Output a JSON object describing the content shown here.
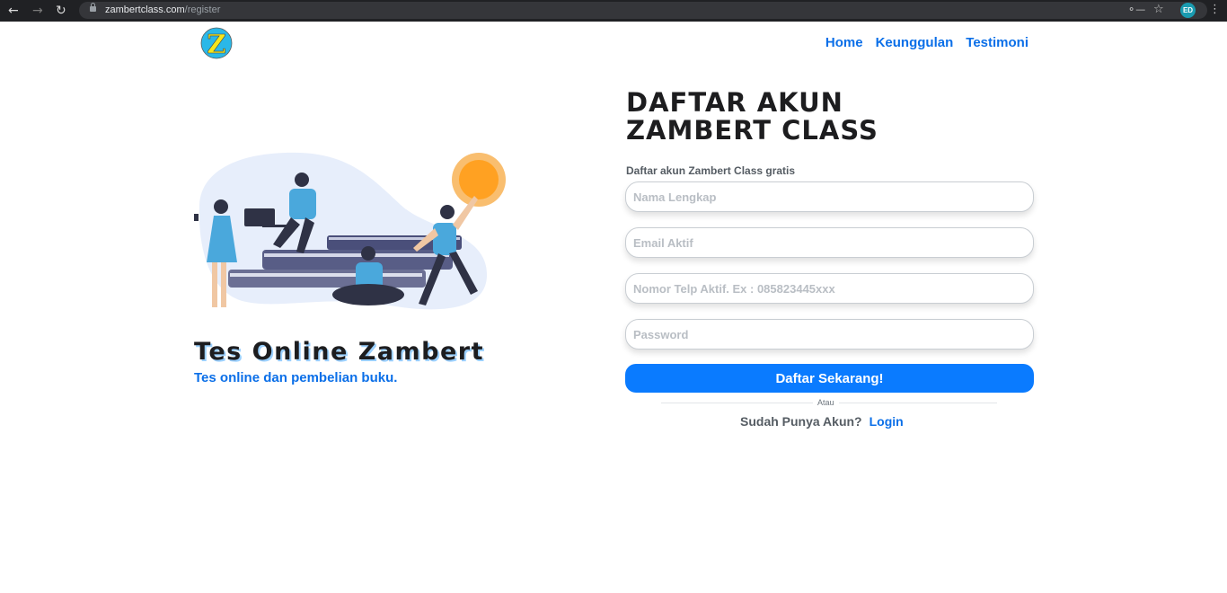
{
  "browser": {
    "url_host": "zambertclass.com",
    "url_path": "/register",
    "profile_initials": "ED"
  },
  "logo": {
    "letter": "Z"
  },
  "nav": {
    "items": [
      "Home",
      "Keunggulan",
      "Testimoni"
    ]
  },
  "hero": {
    "title": "Tes Online Zambert",
    "subtitle": "Tes online dan pembelian buku."
  },
  "form": {
    "title_line1": "DAFTAR AKUN",
    "title_line2": "ZAMBERT CLASS",
    "subtitle": "Daftar akun Zambert Class gratis",
    "fields": {
      "name": {
        "value": "",
        "placeholder": "Nama Lengkap"
      },
      "email": {
        "value": "",
        "placeholder": "Email Aktif"
      },
      "phone": {
        "value": "",
        "placeholder": "Nomor Telp Aktif. Ex : 085823445xxx"
      },
      "password": {
        "value": "",
        "placeholder": "Password"
      }
    },
    "submit_label": "Daftar Sekarang!",
    "divider_text": "Atau",
    "login_prompt": "Sudah Punya Akun?",
    "login_link": "Login"
  },
  "colors": {
    "brand_blue": "#0a7bff",
    "link_blue": "#0b6fe8",
    "logo_circle": "#2ab8e8",
    "logo_letter": "#f5e61b",
    "accent_orange": "#ffa122"
  }
}
